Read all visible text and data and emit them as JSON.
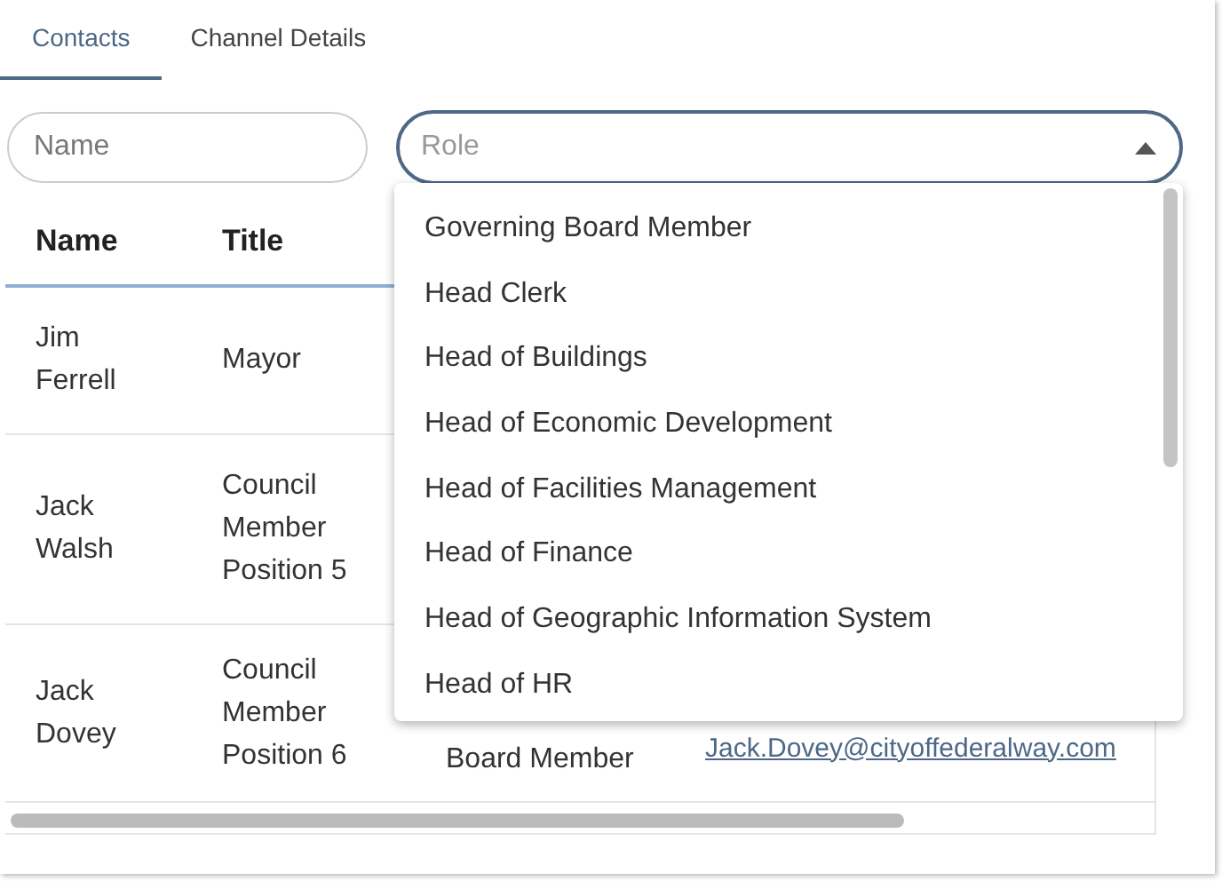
{
  "tabs": [
    {
      "label": "Contacts",
      "selected": true
    },
    {
      "label": "Channel Details",
      "selected": false
    }
  ],
  "filters": {
    "name": {
      "placeholder": "Name"
    },
    "role": {
      "placeholder": "Role",
      "expanded": true
    }
  },
  "table": {
    "columns": [
      "Name",
      "Title"
    ],
    "rows": [
      {
        "name": "Jim Ferrell",
        "title": "Mayor"
      },
      {
        "name": "Jack Walsh",
        "title": "Council Member Position 5"
      },
      {
        "name": "Jack Dovey",
        "title": "Council Member Position 6",
        "column_3": "Board Member",
        "email": "Jack.Dovey@cityoffederalway.com"
      }
    ]
  },
  "role_options": [
    "Governing Board Member",
    "Head Clerk",
    "Head of Buildings",
    "Head of Economic Development",
    "Head of Facilities Management",
    "Head of Finance",
    "Head of Geographic Information System",
    "Head of HR"
  ]
}
